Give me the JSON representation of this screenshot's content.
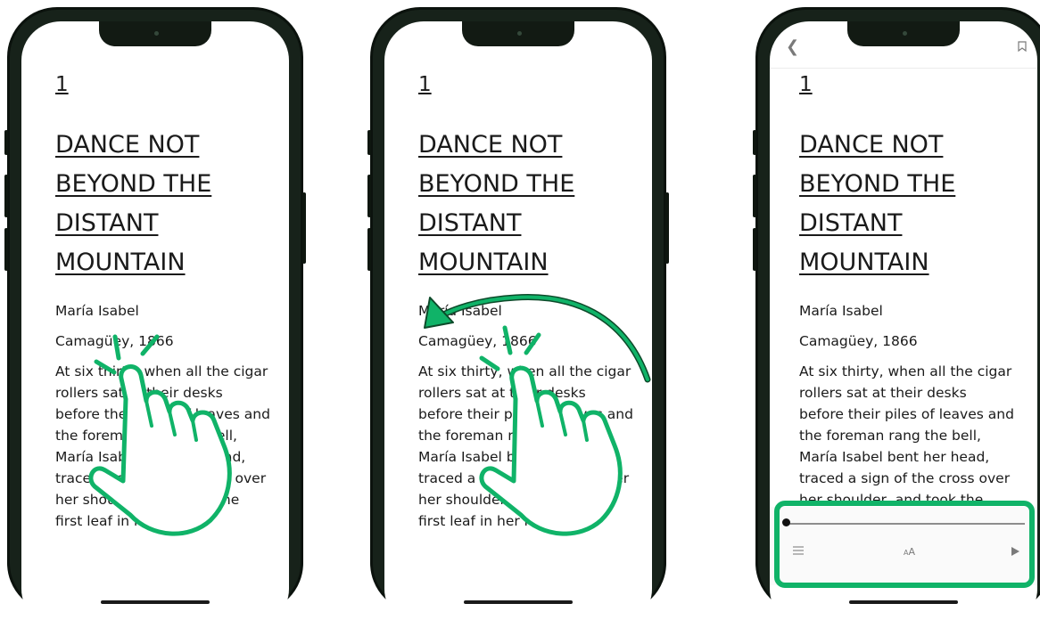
{
  "colors": {
    "accent": "#10b368",
    "phone_frame": "#17221a"
  },
  "book": {
    "chapter_number": "1",
    "chapter_title": "DANCE NOT\nBEYOND THE\nDISTANT\nMOUNTAIN",
    "character": "María Isabel",
    "place": "Camagüey, 1866",
    "body": "At six thirty, when all the cigar\nrollers sat at their desks\nbefore their piles of leaves and\nthe foreman rang the bell,\nMaría Isabel bent her head,\ntraced a sign of the cross over\nher shoulder, and took the\nfirst leaf in her hand."
  },
  "gestures": {
    "phone1": "tap",
    "phone2": "swipe-left"
  },
  "icons": {
    "back": "chevron-left-icon",
    "bookmark": "bookmark-icon",
    "toc": "list-icon",
    "font": "font-size-icon",
    "play": "play-icon"
  },
  "reader_controls": {
    "font_size_label": "AA",
    "progress": 0.0
  }
}
